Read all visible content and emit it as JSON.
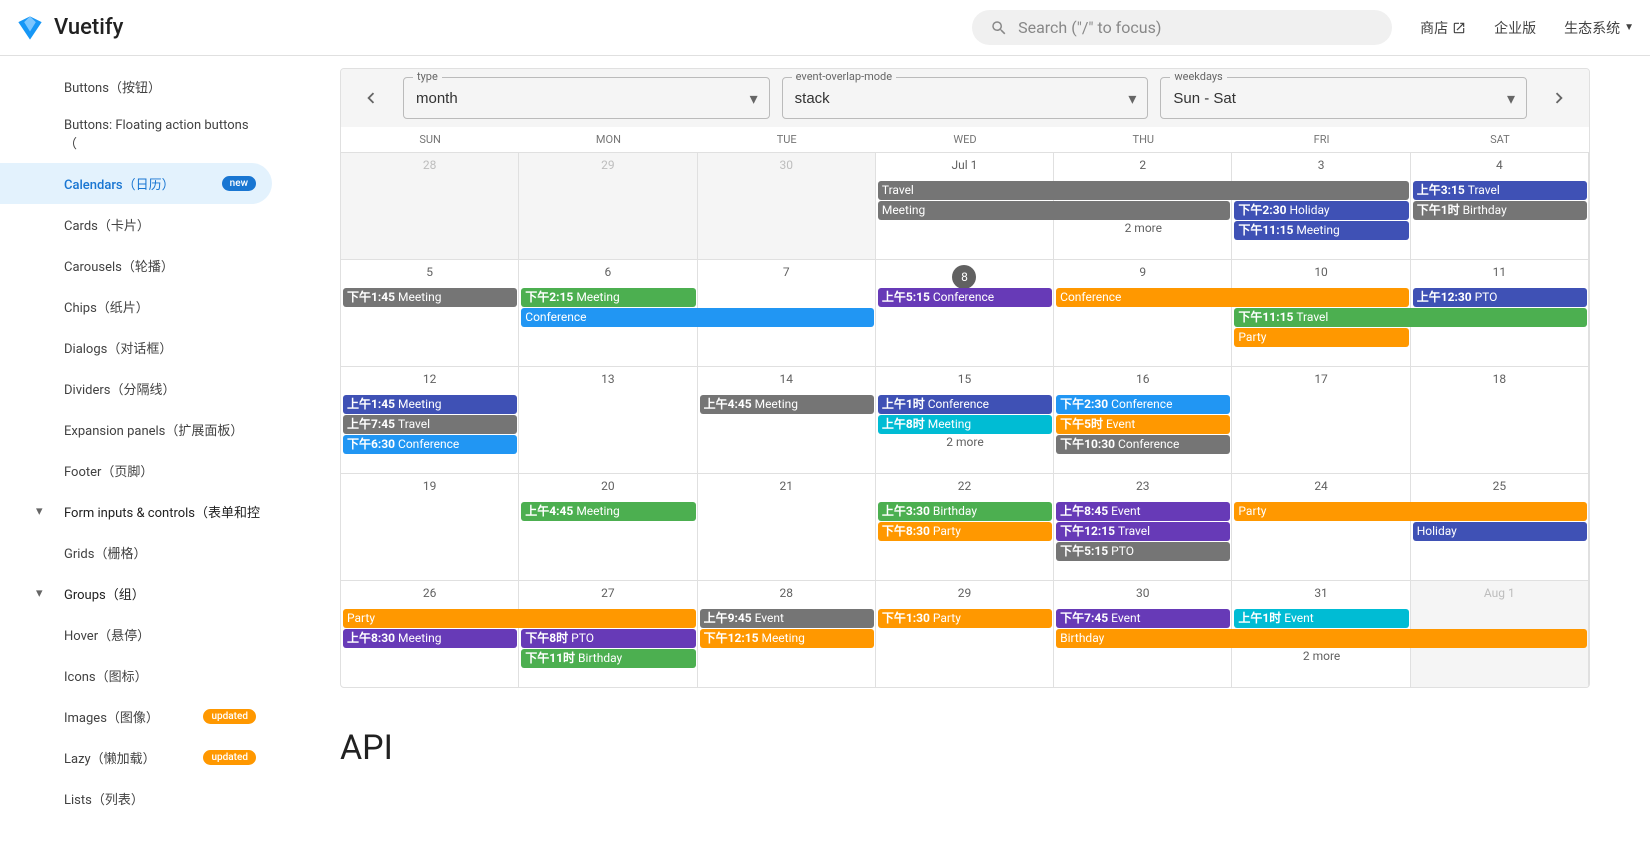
{
  "header": {
    "brand": "Vuetify",
    "search_placeholder": "Search (\"/\" to focus)",
    "links": [
      {
        "label": "商店",
        "external": true
      },
      {
        "label": "企业版"
      },
      {
        "label": "生态系统",
        "dropdown": true
      }
    ]
  },
  "sidebar": {
    "items": [
      {
        "label": "Buttons（按钮）"
      },
      {
        "label": "Buttons: Floating action buttons（"
      },
      {
        "label": "Calendars（日历）",
        "active": true,
        "badge": "new",
        "badge_type": "new"
      },
      {
        "label": "Cards（卡片）"
      },
      {
        "label": "Carousels（轮播）"
      },
      {
        "label": "Chips（纸片）"
      },
      {
        "label": "Dialogs（对话框）"
      },
      {
        "label": "Dividers（分隔线）"
      },
      {
        "label": "Expansion panels（扩展面板）"
      },
      {
        "label": "Footer（页脚）"
      },
      {
        "label": "Form inputs & controls（表单和控",
        "group": true,
        "arrow": true
      },
      {
        "label": "Grids（栅格）"
      },
      {
        "label": "Groups（组）",
        "group": true,
        "arrow": true
      },
      {
        "label": "Hover（悬停）"
      },
      {
        "label": "Icons（图标）"
      },
      {
        "label": "Images（图像）",
        "badge": "updated",
        "badge_type": "updated"
      },
      {
        "label": "Lazy（懒加载）",
        "badge": "updated",
        "badge_type": "updated"
      },
      {
        "label": "Lists（列表）"
      }
    ]
  },
  "calendar": {
    "selects": {
      "type": {
        "label": "type",
        "value": "month"
      },
      "mode": {
        "label": "event-overlap-mode",
        "value": "stack"
      },
      "weekdays": {
        "label": "weekdays",
        "value": "Sun - Sat"
      }
    },
    "weekday_labels": [
      "SUN",
      "MON",
      "TUE",
      "WED",
      "THU",
      "FRI",
      "SAT"
    ],
    "colors": {
      "blue": "#2196f3",
      "indigo": "#3f51b5",
      "deep-purple": "#673ab7",
      "cyan": "#00bcd4",
      "green": "#4caf50",
      "orange": "#ff9800",
      "grey": "#757575"
    },
    "weeks": [
      {
        "days": [
          {
            "num": "28",
            "outside": true
          },
          {
            "num": "29",
            "outside": true
          },
          {
            "num": "30",
            "outside": true
          },
          {
            "num": "Jul 1"
          },
          {
            "num": "2"
          },
          {
            "num": "3"
          },
          {
            "num": "4"
          }
        ],
        "events": [
          {
            "start": 3,
            "span": 3,
            "row": 0,
            "color": "grey",
            "text": "Travel"
          },
          {
            "start": 3,
            "span": 2,
            "row": 1,
            "color": "grey",
            "text": "Meeting"
          },
          {
            "start": 5,
            "span": 1,
            "row": 1,
            "color": "indigo",
            "time": "下午2:30",
            "text": "Holiday"
          },
          {
            "start": 5,
            "span": 1,
            "row": 2,
            "color": "indigo",
            "time": "下午11:15",
            "text": "Meeting"
          },
          {
            "start": 6,
            "span": 1,
            "row": 0,
            "color": "indigo",
            "time": "上午3:15",
            "text": "Travel"
          },
          {
            "start": 6,
            "span": 1,
            "row": 1,
            "color": "grey",
            "time": "下午1时",
            "text": "Birthday"
          }
        ],
        "more": [
          {
            "col": 4,
            "row": 2,
            "text": "2 more"
          }
        ]
      },
      {
        "days": [
          {
            "num": "5"
          },
          {
            "num": "6"
          },
          {
            "num": "7"
          },
          {
            "num": "8",
            "today": true
          },
          {
            "num": "9"
          },
          {
            "num": "10"
          },
          {
            "num": "11"
          }
        ],
        "events": [
          {
            "start": 0,
            "span": 1,
            "row": 0,
            "color": "grey",
            "time": "下午1:45",
            "text": "Meeting"
          },
          {
            "start": 1,
            "span": 1,
            "row": 0,
            "color": "green",
            "time": "下午2:15",
            "text": "Meeting"
          },
          {
            "start": 1,
            "span": 2,
            "row": 1,
            "color": "blue",
            "text": "Conference"
          },
          {
            "start": 3,
            "span": 1,
            "row": 0,
            "color": "deep-purple",
            "time": "上午5:15",
            "text": "Conference"
          },
          {
            "start": 4,
            "span": 2,
            "row": 0,
            "color": "orange",
            "text": "Conference"
          },
          {
            "start": 5,
            "span": 2,
            "row": 1,
            "color": "green",
            "time": "下午11:15",
            "text": "Travel"
          },
          {
            "start": 5,
            "span": 1,
            "row": 2,
            "color": "orange",
            "text": "Party"
          },
          {
            "start": 6,
            "span": 1,
            "row": 0,
            "color": "indigo",
            "time": "上午12:30",
            "text": "PTO"
          }
        ]
      },
      {
        "days": [
          {
            "num": "12"
          },
          {
            "num": "13"
          },
          {
            "num": "14"
          },
          {
            "num": "15"
          },
          {
            "num": "16"
          },
          {
            "num": "17"
          },
          {
            "num": "18"
          }
        ],
        "events": [
          {
            "start": 0,
            "span": 1,
            "row": 0,
            "color": "indigo",
            "time": "上午1:45",
            "text": "Meeting"
          },
          {
            "start": 0,
            "span": 1,
            "row": 1,
            "color": "grey",
            "time": "上午7:45",
            "text": "Travel"
          },
          {
            "start": 0,
            "span": 1,
            "row": 2,
            "color": "blue",
            "time": "下午6:30",
            "text": "Conference"
          },
          {
            "start": 2,
            "span": 1,
            "row": 0,
            "color": "grey",
            "time": "上午4:45",
            "text": "Meeting"
          },
          {
            "start": 3,
            "span": 1,
            "row": 0,
            "color": "indigo",
            "time": "上午1时",
            "text": "Conference"
          },
          {
            "start": 3,
            "span": 1,
            "row": 1,
            "color": "cyan",
            "time": "上午8时",
            "text": "Meeting"
          },
          {
            "start": 4,
            "span": 1,
            "row": 0,
            "color": "blue",
            "time": "下午2:30",
            "text": "Conference"
          },
          {
            "start": 4,
            "span": 1,
            "row": 1,
            "color": "orange",
            "time": "下午5时",
            "text": "Event"
          },
          {
            "start": 4,
            "span": 1,
            "row": 2,
            "color": "grey",
            "time": "下午10:30",
            "text": "Conference"
          }
        ],
        "more": [
          {
            "col": 3,
            "row": 2,
            "text": "2 more"
          }
        ]
      },
      {
        "days": [
          {
            "num": "19"
          },
          {
            "num": "20"
          },
          {
            "num": "21"
          },
          {
            "num": "22"
          },
          {
            "num": "23"
          },
          {
            "num": "24"
          },
          {
            "num": "25"
          }
        ],
        "events": [
          {
            "start": 1,
            "span": 1,
            "row": 0,
            "color": "green",
            "time": "上午4:45",
            "text": "Meeting"
          },
          {
            "start": 3,
            "span": 1,
            "row": 0,
            "color": "green",
            "time": "上午3:30",
            "text": "Birthday"
          },
          {
            "start": 3,
            "span": 1,
            "row": 1,
            "color": "orange",
            "time": "下午8:30",
            "text": "Party"
          },
          {
            "start": 4,
            "span": 1,
            "row": 0,
            "color": "deep-purple",
            "time": "上午8:45",
            "text": "Event"
          },
          {
            "start": 4,
            "span": 1,
            "row": 1,
            "color": "deep-purple",
            "time": "下午12:15",
            "text": "Travel"
          },
          {
            "start": 4,
            "span": 1,
            "row": 2,
            "color": "grey",
            "time": "下午5:15",
            "text": "PTO"
          },
          {
            "start": 5,
            "span": 2,
            "row": 0,
            "color": "orange",
            "text": "Party"
          },
          {
            "start": 6,
            "span": 1,
            "row": 1,
            "color": "indigo",
            "text": "Holiday"
          }
        ]
      },
      {
        "days": [
          {
            "num": "26"
          },
          {
            "num": "27"
          },
          {
            "num": "28"
          },
          {
            "num": "29"
          },
          {
            "num": "30"
          },
          {
            "num": "31"
          },
          {
            "num": "Aug 1",
            "outside": true
          }
        ],
        "events": [
          {
            "start": 0,
            "span": 2,
            "row": 0,
            "color": "orange",
            "text": "Party"
          },
          {
            "start": 0,
            "span": 1,
            "row": 1,
            "color": "deep-purple",
            "time": "上午8:30",
            "text": "Meeting"
          },
          {
            "start": 1,
            "span": 1,
            "row": 1,
            "color": "deep-purple",
            "time": "下午8时",
            "text": "PTO"
          },
          {
            "start": 1,
            "span": 1,
            "row": 2,
            "color": "green",
            "time": "下午11时",
            "text": "Birthday"
          },
          {
            "start": 2,
            "span": 1,
            "row": 0,
            "color": "grey",
            "time": "上午9:45",
            "text": "Event"
          },
          {
            "start": 2,
            "span": 1,
            "row": 1,
            "color": "orange",
            "time": "下午12:15",
            "text": "Meeting"
          },
          {
            "start": 3,
            "span": 1,
            "row": 0,
            "color": "orange",
            "time": "下午1:30",
            "text": "Party"
          },
          {
            "start": 4,
            "span": 1,
            "row": 0,
            "color": "deep-purple",
            "time": "下午7:45",
            "text": "Event"
          },
          {
            "start": 4,
            "span": 3,
            "row": 1,
            "color": "orange",
            "text": "Birthday"
          },
          {
            "start": 5,
            "span": 1,
            "row": 0,
            "color": "cyan",
            "time": "上午1时",
            "text": "Event"
          }
        ],
        "more": [
          {
            "col": 5,
            "row": 2,
            "text": "2 more"
          }
        ]
      }
    ]
  },
  "api_heading": "API"
}
